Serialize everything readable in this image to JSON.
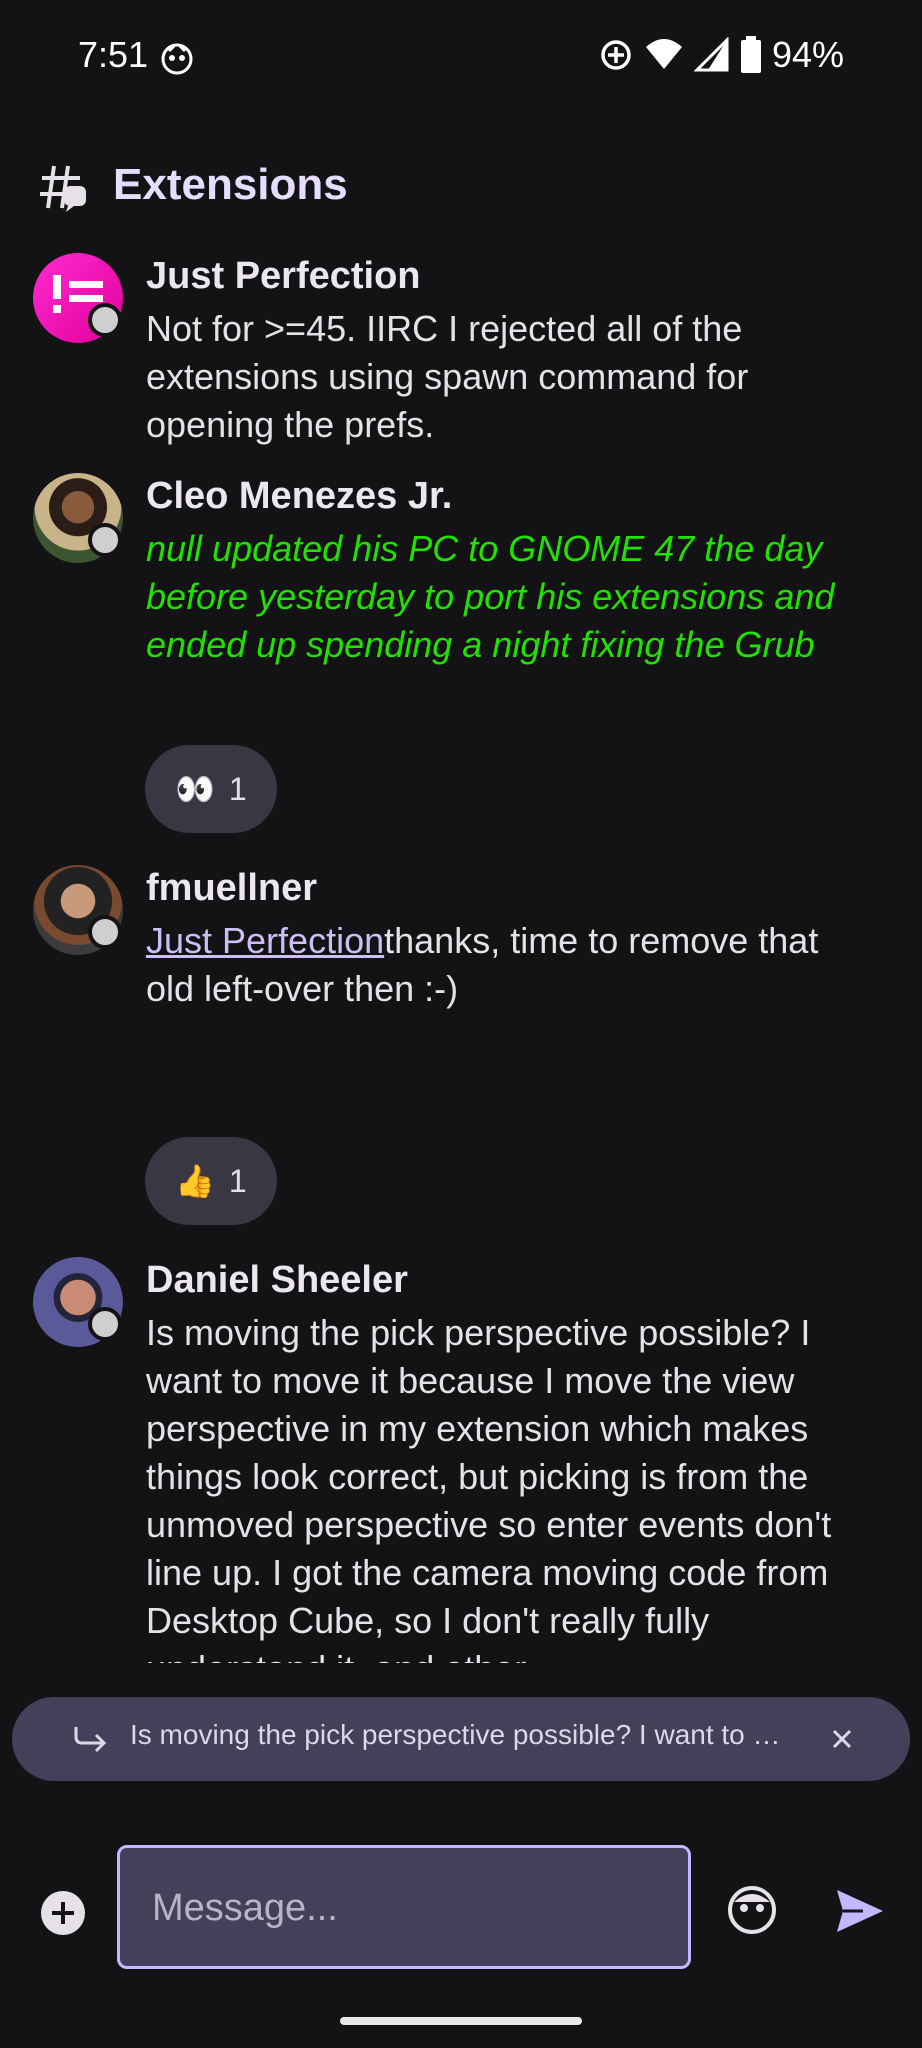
{
  "status_bar": {
    "time": "7:51",
    "battery": "94%"
  },
  "channel": {
    "title": "Extensions"
  },
  "messages": [
    {
      "author": "Just Perfection",
      "body": "Not for >=45. IIRC I rejected all of the extensions using spawn command for opening the prefs."
    },
    {
      "author": "Cleo Menezes Jr.",
      "body": "null updated his PC to GNOME 47 the day before yesterday to port his extensions and ended up spending a night fixing the Grub",
      "reaction": {
        "emoji": "👀",
        "count": "1"
      }
    },
    {
      "author": "fmuellner",
      "mention": "Just Perfection",
      "body": "thanks, time to remove that old left-over then :-)",
      "reaction": {
        "emoji": "👍",
        "count": "1"
      }
    },
    {
      "author": "Daniel Sheeler",
      "body": "Is moving the pick perspective possible?  I want to move it because I move the view perspective in my extension which makes things look correct, but picking is from the unmoved perspective so enter events don't line up.  I got the camera moving code from Desktop Cube, so I don't really fully understand it, and other"
    }
  ],
  "reply_preview": {
    "text": "Is moving the pick perspective possible?  I want to move it because I move the view perspective"
  },
  "composer": {
    "placeholder": "Message..."
  },
  "colors": {
    "accent": "#c4b6ff",
    "green_text": "#22e000",
    "background": "#131315"
  }
}
